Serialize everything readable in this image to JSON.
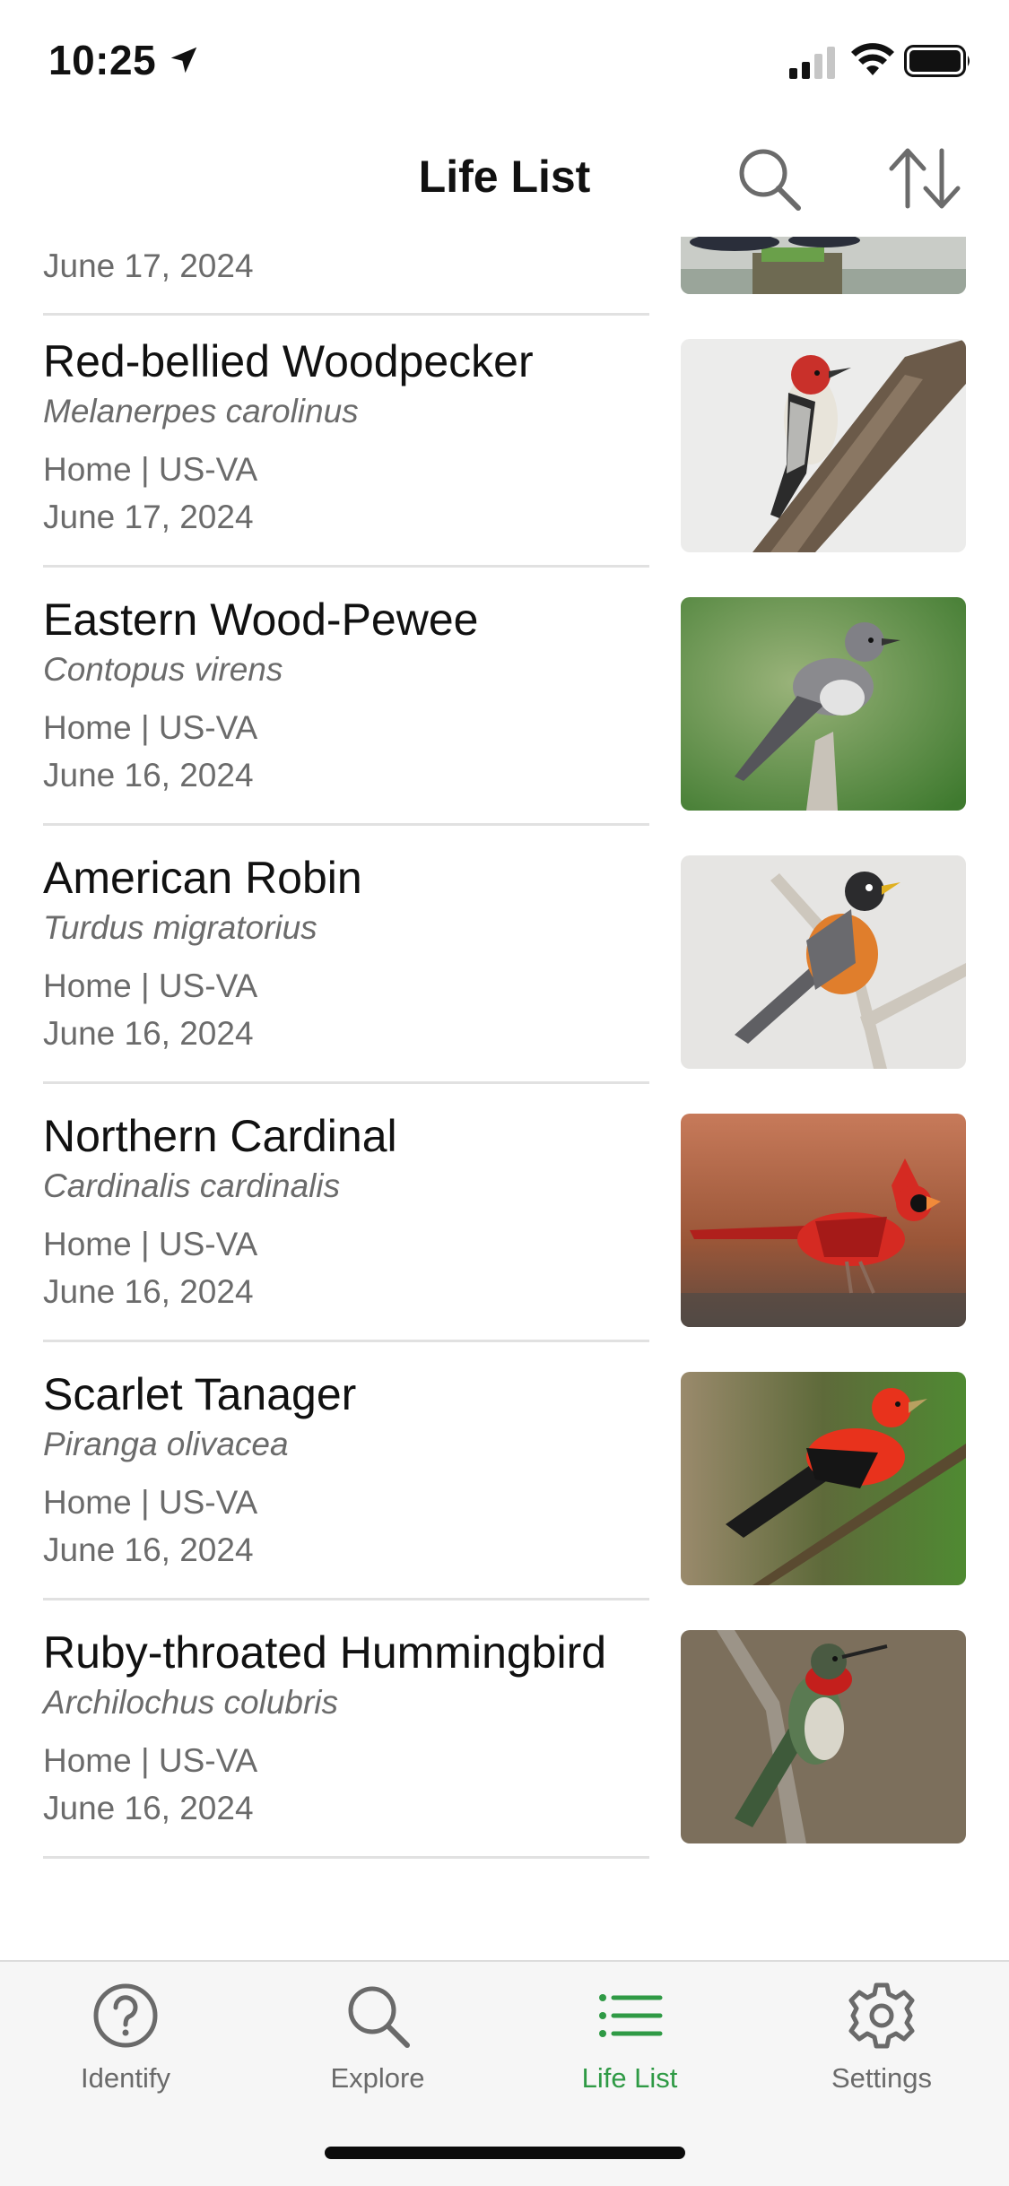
{
  "status_bar": {
    "time": "10:25"
  },
  "header": {
    "title": "Life List",
    "search_icon": "search-icon",
    "sort_icon": "sort-icon"
  },
  "list": {
    "partial_item": {
      "date": "June 17, 2024"
    },
    "items": [
      {
        "common_name": "Red-bellied Woodpecker",
        "scientific_name": "Melanerpes carolinus",
        "location": "Home | US-VA",
        "date": "June 17, 2024"
      },
      {
        "common_name": "Eastern Wood-Pewee",
        "scientific_name": "Contopus virens",
        "location": "Home | US-VA",
        "date": "June 16, 2024"
      },
      {
        "common_name": "American Robin",
        "scientific_name": "Turdus migratorius",
        "location": "Home | US-VA",
        "date": "June 16, 2024"
      },
      {
        "common_name": "Northern Cardinal",
        "scientific_name": "Cardinalis cardinalis",
        "location": "Home | US-VA",
        "date": "June 16, 2024"
      },
      {
        "common_name": "Scarlet Tanager",
        "scientific_name": "Piranga olivacea",
        "location": "Home | US-VA",
        "date": "June 16, 2024"
      },
      {
        "common_name": "Ruby-throated Hummingbird",
        "scientific_name": "Archilochus colubris",
        "location": "Home | US-VA",
        "date": "June 16, 2024"
      }
    ]
  },
  "tab_bar": {
    "tabs": [
      {
        "label": "Identify",
        "icon": "question-circle-icon"
      },
      {
        "label": "Explore",
        "icon": "search-icon"
      },
      {
        "label": "Life List",
        "icon": "list-icon",
        "active": true
      },
      {
        "label": "Settings",
        "icon": "gear-icon"
      }
    ]
  },
  "colors": {
    "accent": "#2f9a45",
    "secondary_text": "#6b6b6b",
    "divider": "#e1e1e1"
  }
}
